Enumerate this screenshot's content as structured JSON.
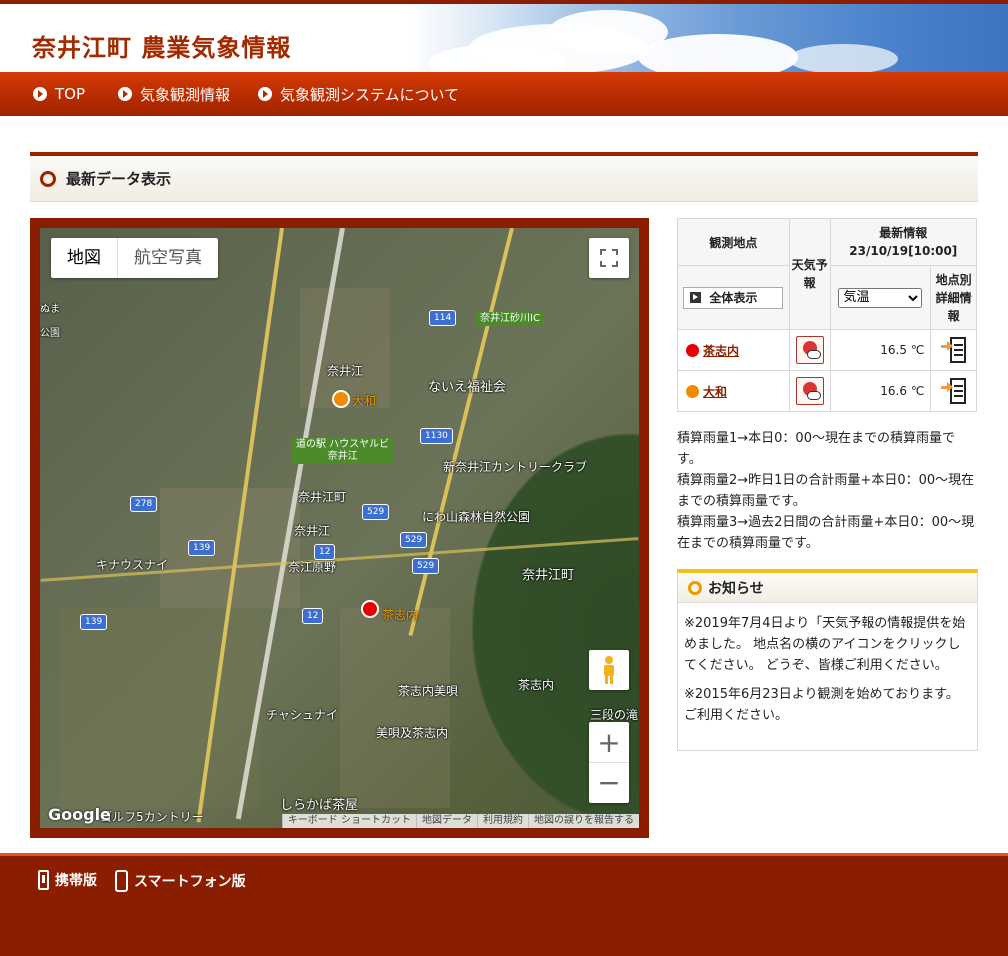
{
  "site": {
    "title": "奈井江町 農業気象情報"
  },
  "nav": {
    "items": [
      {
        "label": "TOP"
      },
      {
        "label": "気象観測情報"
      },
      {
        "label": "気象観測システムについて"
      }
    ]
  },
  "section": {
    "title": "最新データ表示"
  },
  "map": {
    "buttons": {
      "map": "地図",
      "satellite": "航空写真"
    },
    "labels": {
      "naie": "奈井江",
      "naiefukushi": "ないえ福祉会",
      "michinoeki": "道の駅 ハウスヤルビ\n奈井江",
      "shinnaie": "新奈井江カントリークラブ",
      "naiecho": "奈井江町",
      "niwayama": "にわ山森林自然公園",
      "naiesta": "奈井江",
      "kinausunai": "キナウスナイ",
      "naiehara": "奈江原野",
      "naiecho2": "奈井江町",
      "chashinai_pin": "茶志内",
      "chashinaibibai": "茶志内美唄",
      "chashinai": "茶志内",
      "chashunai": "チャシュナイ",
      "bibaichashinai": "美唄及茶志内",
      "sandan": "三段の滝",
      "shirakaba": "しらかば茶屋",
      "golf": "ゴルフ5カントリー",
      "numa": "ぬま",
      "ko": "公園",
      "ic": "奈井江砂川IC",
      "yamato_pin": "大和"
    },
    "shields": {
      "r114": "114",
      "r1130": "1130",
      "r278": "278",
      "r529a": "529",
      "r529b": "529",
      "r529c": "529",
      "r12a": "12",
      "r12b": "12",
      "r139a": "139",
      "r139b": "139"
    },
    "attribution": [
      "キーボード ショートカット",
      "地図データ",
      "利用規約",
      "地図の誤りを報告する"
    ],
    "google": "Google",
    "colors": {
      "red_pin": "#e60000",
      "orange_pin": "#f08a00"
    }
  },
  "table": {
    "col_station": "観測地点",
    "col_forecast": "天気予報",
    "col_latest": "最新情報",
    "timestamp": "23/10/19[10:00]",
    "col_detail": "地点別詳細情報",
    "show_all": "全体表示",
    "select_value": "気温",
    "rows": [
      {
        "name": "茶志内",
        "value": "16.5 ℃",
        "color": "#e60000"
      },
      {
        "name": "大和",
        "value": "16.6 ℃",
        "color": "#f08a00"
      }
    ]
  },
  "notes": [
    "積算雨量1→本日0：00〜現在までの積算雨量です。",
    "積算雨量2→昨日1日の合計雨量+本日0：00〜現在までの積算雨量です。",
    "積算雨量3→過去2日間の合計雨量+本日0：00〜現在までの積算雨量です。"
  ],
  "news": {
    "title": "お知らせ",
    "items": [
      "※2019年7月4日より「天気予報の情報提供を始めました。 地点名の横のアイコンをクリックしてください。 どうぞ、皆様ご利用ください。",
      "※2015年6月23日より観測を始めております。 ご利用ください。"
    ]
  },
  "footer": {
    "mobile": "携帯版",
    "smartphone": "スマートフォン版"
  }
}
